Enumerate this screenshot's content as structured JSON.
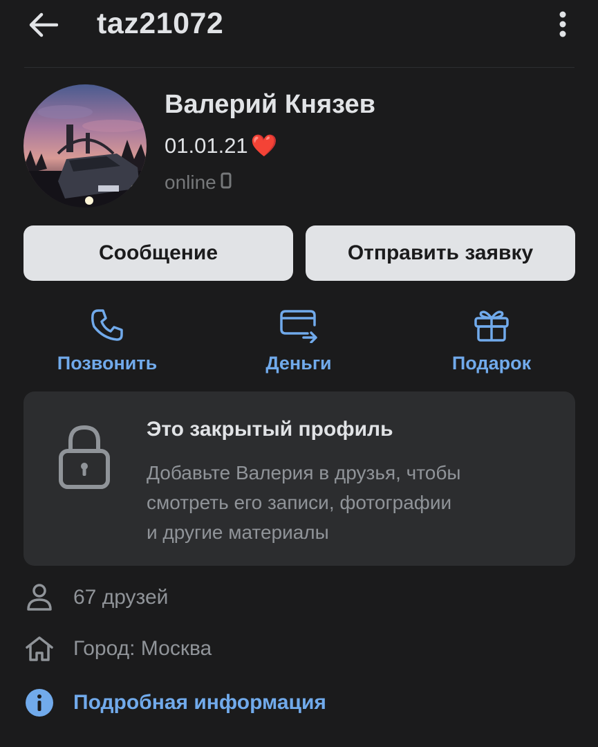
{
  "header": {
    "username": "taz21072",
    "back_icon": "arrow-left-icon",
    "more_icon": "more-vertical-icon"
  },
  "profile": {
    "name": "Валерий Князев",
    "status": "01.01.21",
    "status_emoji": "❤️",
    "online": "online",
    "online_device_icon": "phone-icon"
  },
  "buttons": {
    "message": "Сообщение",
    "add_friend": "Отправить заявку"
  },
  "actions": [
    {
      "label": "Позвонить",
      "icon": "phone-call-icon"
    },
    {
      "label": "Деньги",
      "icon": "money-transfer-icon"
    },
    {
      "label": "Подарок",
      "icon": "gift-icon"
    }
  ],
  "private_profile": {
    "title": "Это закрытый профиль",
    "text_line1": "Добавьте Валерия в друзья, чтобы",
    "text_line2": "смотреть его записи, фотографии",
    "text_line3": "и другие материалы",
    "icon": "lock-icon"
  },
  "info": {
    "friends": "67 друзей",
    "city": "Город: Москва",
    "details": "Подробная информация"
  },
  "colors": {
    "background": "#1b1b1c",
    "card": "#2c2d2f",
    "accent": "#71aaeb",
    "button": "#e1e3e6",
    "muted": "#909499"
  }
}
